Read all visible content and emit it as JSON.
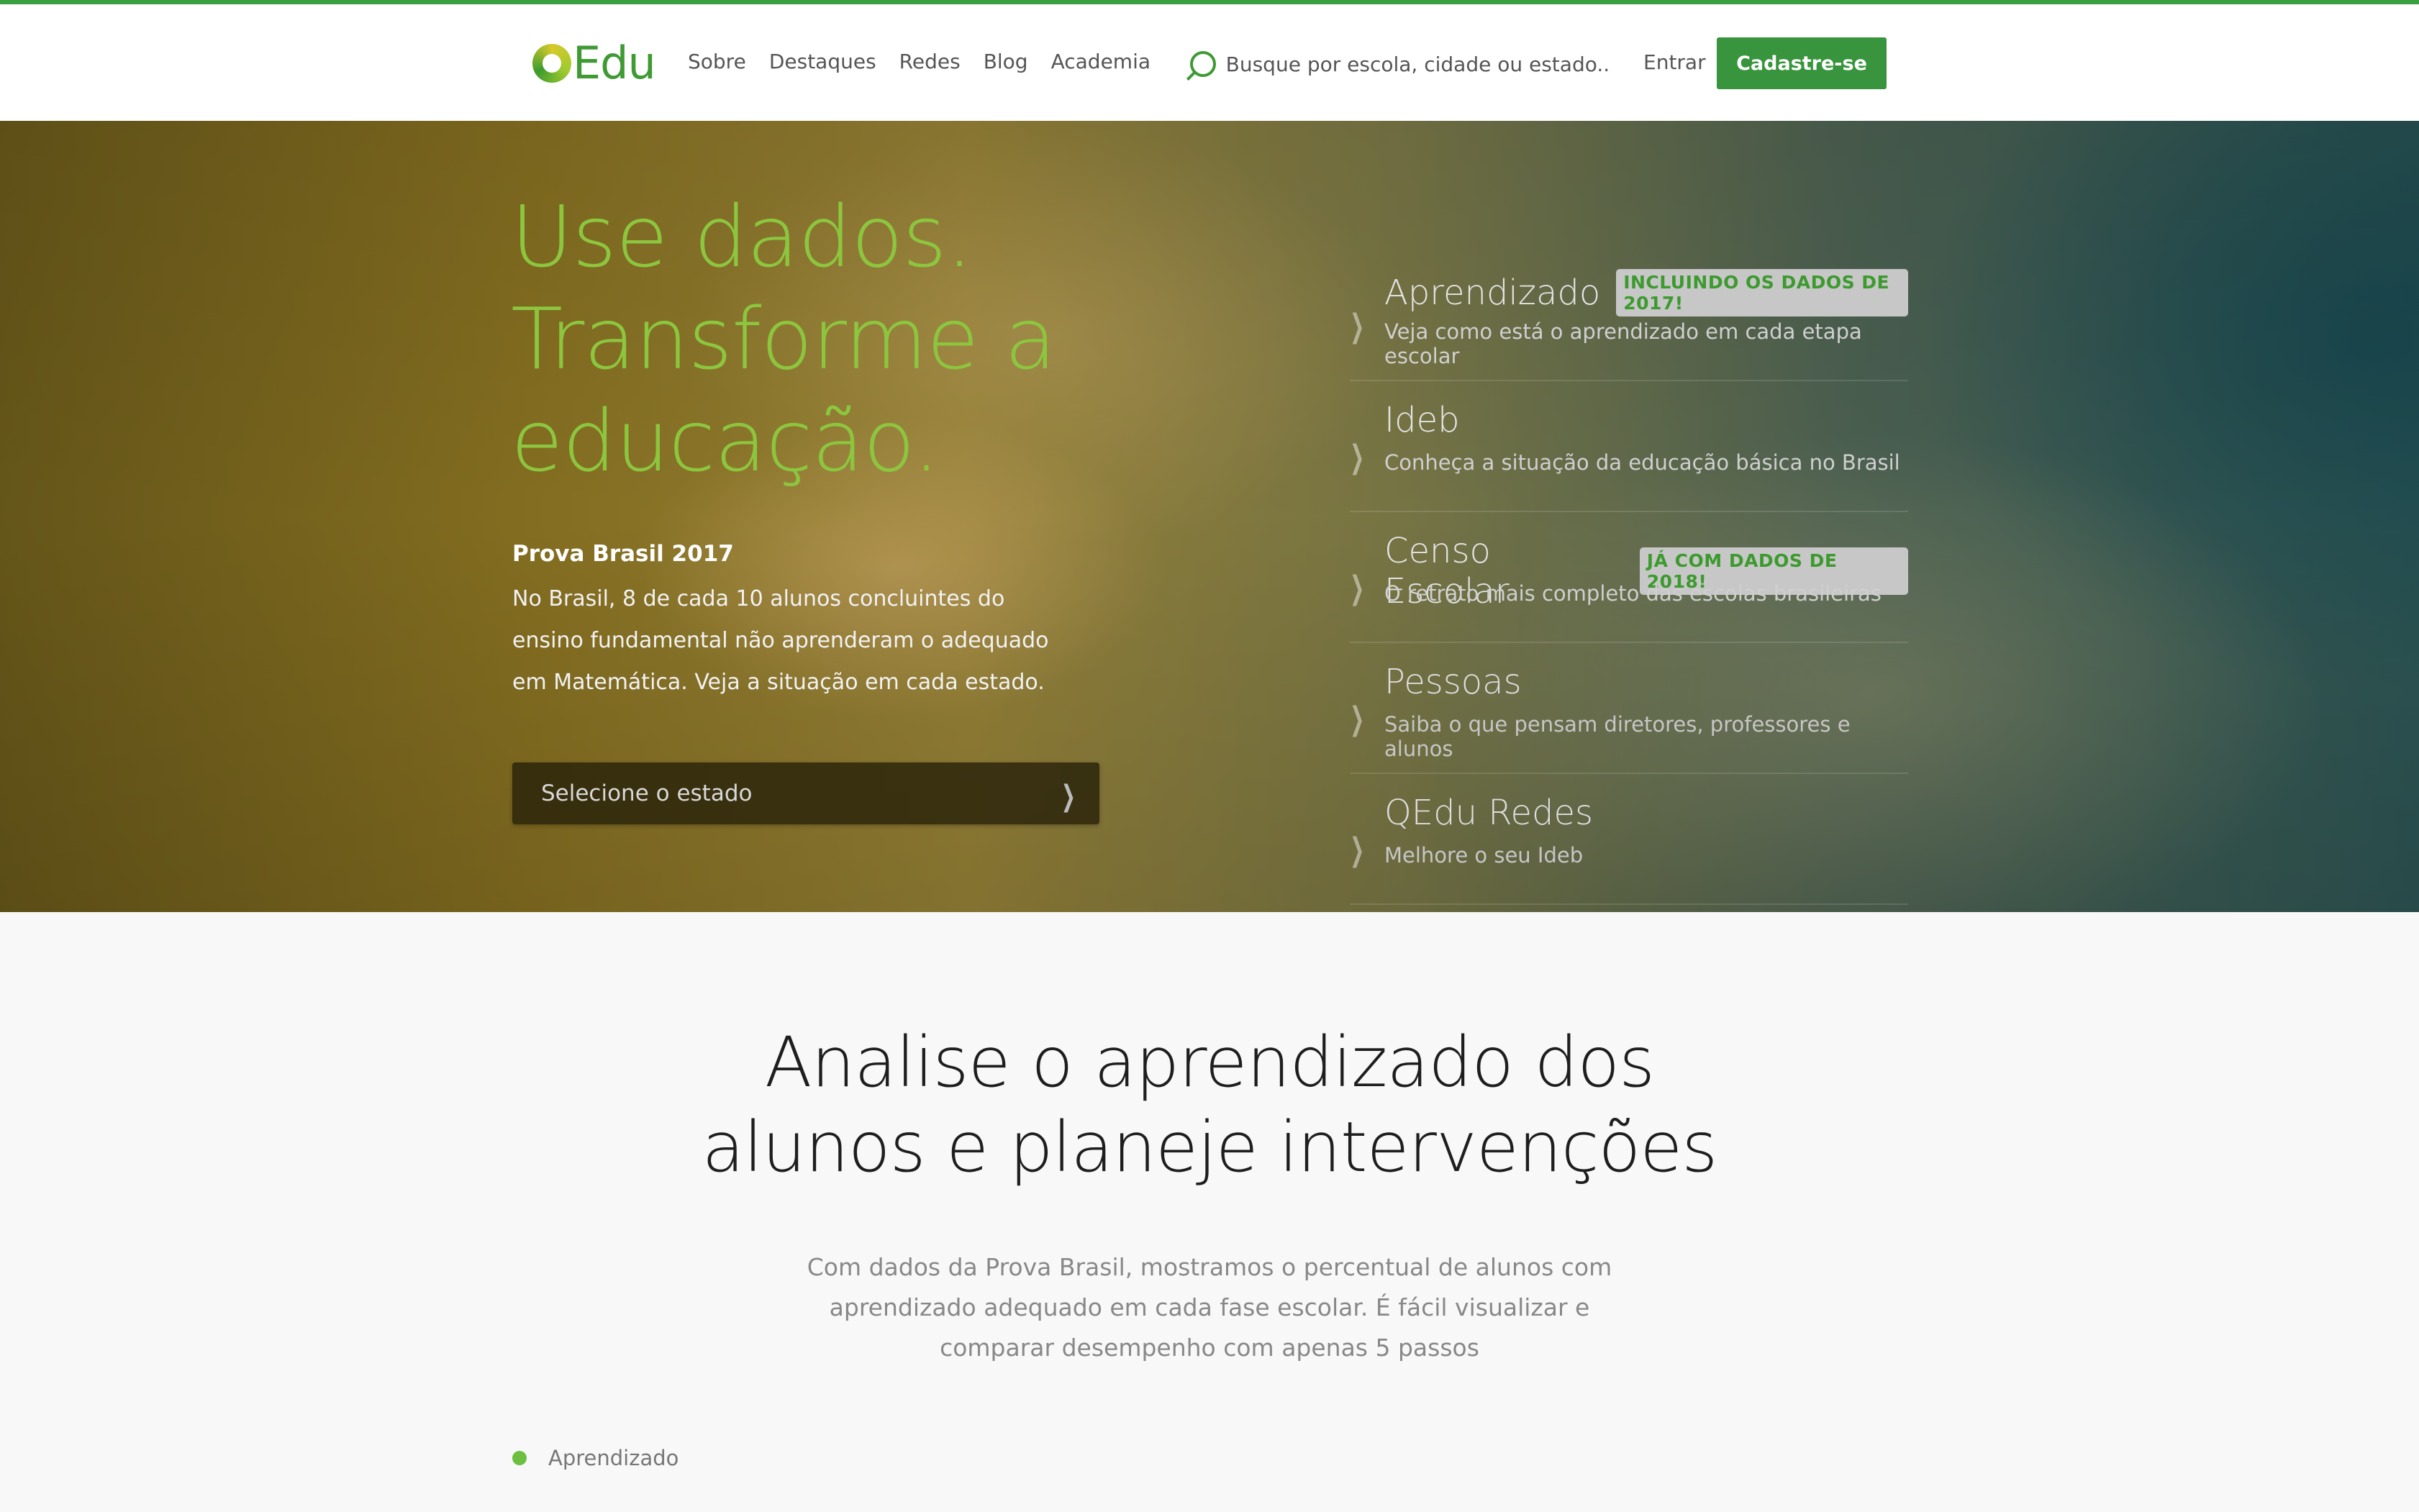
{
  "header": {
    "logo_text": "Edu",
    "nav": [
      "Sobre",
      "Destaques",
      "Redes",
      "Blog",
      "Academia"
    ],
    "search_placeholder": "Busque por escola, cidade ou estado...",
    "login_label": "Entrar",
    "signup_label": "Cadastre-se"
  },
  "hero": {
    "headline": "Use dados. Transforme a educação.",
    "prova_title": "Prova Brasil 2017",
    "prova_text": "No Brasil, 8 de cada 10 alunos concluintes do ensino fundamental não aprenderam o adequado em Matemática. Veja a situação em cada estado.",
    "state_select_label": "Selecione o estado",
    "features": [
      {
        "title": "Aprendizado",
        "badge": "INCLUINDO OS DADOS DE 2017!",
        "subtitle": "Veja como está o aprendizado em cada etapa escolar"
      },
      {
        "title": "Ideb",
        "subtitle": "Conheça a situação da educação básica no Brasil"
      },
      {
        "title": "Censo Escolar",
        "badge": "JÁ COM DADOS DE 2018!",
        "subtitle": "O retrato mais completo das escolas brasileiras"
      },
      {
        "title": "Pessoas",
        "subtitle": "Saiba o que pensam diretores, professores e alunos"
      },
      {
        "title": "QEdu Redes",
        "subtitle": "Melhore o seu Ideb"
      }
    ]
  },
  "section": {
    "title_line1": "Analise o aprendizado dos",
    "title_line2": "alunos e planeje intervenções",
    "text": "Com dados da Prova Brasil, mostramos o percentual de alunos com aprendizado adequado em cada fase escolar. É fácil visualizar e comparar desempenho com apenas 5 passos",
    "tab_label": "Aprendizado"
  },
  "colors": {
    "brand_green": "#38943d",
    "headline_green": "#8cc63f",
    "badge_green": "#3c9a2e"
  }
}
